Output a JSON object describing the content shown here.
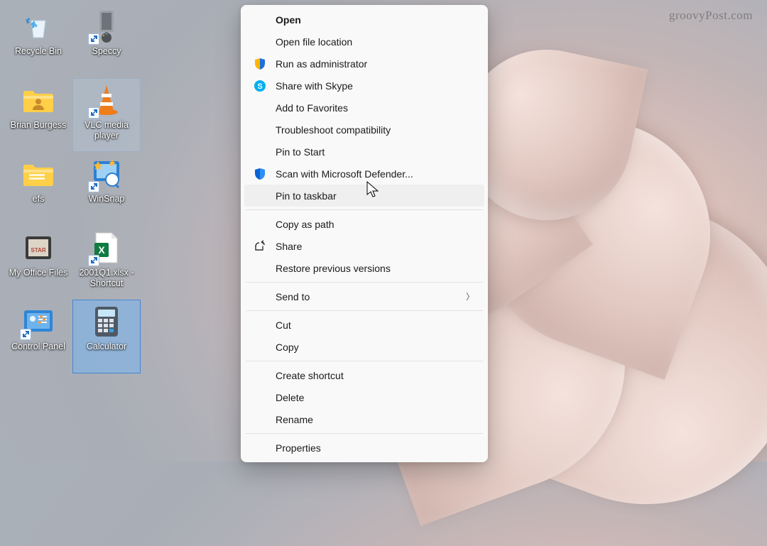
{
  "watermark": "groovyPost.com",
  "desktop": {
    "icons_col1": [
      {
        "id": "recycle-bin",
        "label": "Recycle Bin",
        "shortcut": false
      },
      {
        "id": "brian-burgess",
        "label": "Brian Burgess",
        "shortcut": false
      },
      {
        "id": "efs",
        "label": "efs",
        "shortcut": false
      },
      {
        "id": "my-office-files",
        "label": "My Office Files",
        "shortcut": false
      },
      {
        "id": "control-panel",
        "label": "Control Panel",
        "shortcut": true
      }
    ],
    "icons_col2": [
      {
        "id": "speccy",
        "label": "Speccy",
        "shortcut": true
      },
      {
        "id": "vlc",
        "label": "VLC media player",
        "shortcut": true,
        "selected": true
      },
      {
        "id": "winsnap",
        "label": "WinSnap",
        "shortcut": true
      },
      {
        "id": "excel-file",
        "label": "2001Q1.xlsx - Shortcut",
        "shortcut": true
      },
      {
        "id": "calculator",
        "label": "Calculator",
        "shortcut": false,
        "highlight": true
      }
    ]
  },
  "context_menu": {
    "groups": [
      [
        {
          "id": "open",
          "label": "Open",
          "bold": true,
          "icon": null
        },
        {
          "id": "open-file-location",
          "label": "Open file location",
          "icon": null
        },
        {
          "id": "run-as-admin",
          "label": "Run as administrator",
          "icon": "shield-yellow"
        },
        {
          "id": "share-skype",
          "label": "Share with Skype",
          "icon": "skype"
        },
        {
          "id": "add-favorites",
          "label": "Add to Favorites",
          "icon": null
        },
        {
          "id": "troubleshoot",
          "label": "Troubleshoot compatibility",
          "icon": null
        },
        {
          "id": "pin-start",
          "label": "Pin to Start",
          "icon": null
        },
        {
          "id": "scan-defender",
          "label": "Scan with Microsoft Defender...",
          "icon": "shield-blue"
        },
        {
          "id": "pin-taskbar",
          "label": "Pin to taskbar",
          "icon": null,
          "hover": true
        }
      ],
      [
        {
          "id": "copy-path",
          "label": "Copy as path",
          "icon": null
        },
        {
          "id": "share",
          "label": "Share",
          "icon": "share"
        },
        {
          "id": "restore-versions",
          "label": "Restore previous versions",
          "icon": null
        }
      ],
      [
        {
          "id": "send-to",
          "label": "Send to",
          "icon": null,
          "submenu": true
        }
      ],
      [
        {
          "id": "cut",
          "label": "Cut",
          "icon": null
        },
        {
          "id": "copy",
          "label": "Copy",
          "icon": null
        }
      ],
      [
        {
          "id": "create-shortcut",
          "label": "Create shortcut",
          "icon": null
        },
        {
          "id": "delete",
          "label": "Delete",
          "icon": null
        },
        {
          "id": "rename",
          "label": "Rename",
          "icon": null
        }
      ],
      [
        {
          "id": "properties",
          "label": "Properties",
          "icon": null
        }
      ]
    ]
  }
}
